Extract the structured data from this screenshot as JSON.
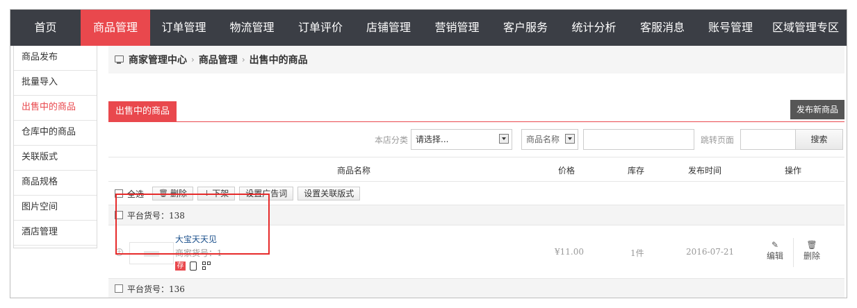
{
  "nav": {
    "items": [
      "首页",
      "商品管理",
      "订单管理",
      "物流管理",
      "订单评价",
      "店铺管理",
      "营销管理",
      "客户服务",
      "统计分析",
      "客服消息",
      "账号管理",
      "区域管理专区"
    ],
    "active_index": 1
  },
  "sidebar": {
    "items": [
      "商品发布",
      "批量导入",
      "出售中的商品",
      "仓库中的商品",
      "关联版式",
      "商品规格",
      "图片空间",
      "酒店管理"
    ],
    "active_index": 2
  },
  "breadcrumb": {
    "icon": "monitor-icon",
    "items": [
      "商家管理中心",
      "商品管理",
      "出售中的商品"
    ],
    "separator": "›"
  },
  "tabs": {
    "active_label": "出售中的商品",
    "publish_button": "发布新商品"
  },
  "filter": {
    "shop_category_label": "本店分类",
    "shop_category_value": "请选择...",
    "search_type_value": "商品名称",
    "search_text": "",
    "jump_label": "跳转页面",
    "jump_value": "",
    "search_button": "搜索"
  },
  "table": {
    "headers": {
      "name": "商品名称",
      "price": "价格",
      "stock": "库存",
      "date": "发布时间",
      "ops": "操作"
    }
  },
  "actions": {
    "select_all": "全选",
    "delete": "删除",
    "unshelve": "下架",
    "set_ad_words": "设置广告词",
    "set_layout": "设置关联版式"
  },
  "groups": [
    {
      "platform_code": "平台货号：138",
      "product": {
        "name": "大宝天天见",
        "merchant_code": "商家货号：1",
        "inventory_badge": "存",
        "price": "¥11.00",
        "stock": "1件",
        "date": "2016-07-21",
        "edit_label": "编辑",
        "delete_label": "删除"
      }
    },
    {
      "platform_code": "平台货号：136"
    }
  ],
  "colors": {
    "accent": "#e9484d",
    "nav_bg": "#3b3e45",
    "highlight": "#e62a2a"
  }
}
